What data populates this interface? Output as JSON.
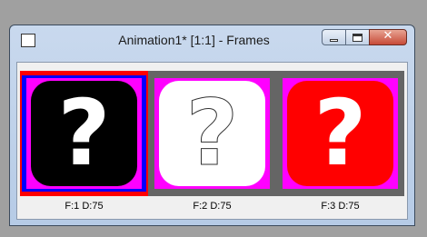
{
  "window": {
    "title": "Animation1* [1:1] - Frames",
    "sys_icon_text": "▌"
  },
  "controls": {
    "minimize": "minimize",
    "maximize": "maximize",
    "close": "✕"
  },
  "frames": [
    {
      "label": "F:1  D:75",
      "glyph": "?",
      "selected": true,
      "bg": "#000000",
      "fg": "#ffffff"
    },
    {
      "label": "F:2  D:75",
      "glyph": "?",
      "selected": false,
      "bg": "#ffffff",
      "fg": "#ffffff"
    },
    {
      "label": "F:3  D:75",
      "glyph": "?",
      "selected": false,
      "bg": "#ff0000",
      "fg": "#ffffff"
    }
  ],
  "colors": {
    "selection_outer": "#ff0000",
    "selection_inner": "#0000ff",
    "transparent_key": "#ff00ff",
    "frame_bg": "#656565"
  }
}
